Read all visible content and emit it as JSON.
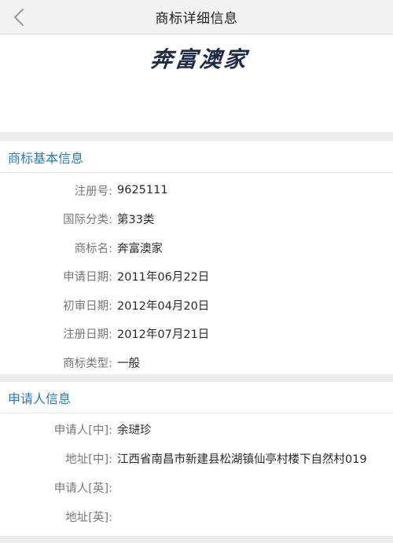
{
  "header": {
    "title": "商标详细信息",
    "back_icon": "chevron-left-icon"
  },
  "logo": {
    "text": "奔富澳家"
  },
  "basic_info": {
    "title": "商标基本信息",
    "rows": [
      {
        "label": "注册号:",
        "value": "9625111"
      },
      {
        "label": "国际分类:",
        "value": "第33类"
      },
      {
        "label": "商标名:",
        "value": "奔富澳家"
      },
      {
        "label": "申请日期:",
        "value": "2011年06月22日"
      },
      {
        "label": "初审日期:",
        "value": "2012年04月20日"
      },
      {
        "label": "注册日期:",
        "value": "2012年07月21日"
      },
      {
        "label": "商标类型:",
        "value": "一般"
      }
    ]
  },
  "applicant_info": {
    "title": "申请人信息",
    "rows": [
      {
        "label": "申请人[中]:",
        "value": "余琎珍"
      },
      {
        "label": "地址[中]:",
        "value": "江西省南昌市新建县松湖镇仙亭村楼下自然村019"
      },
      {
        "label": "申请人[英]:",
        "value": ""
      },
      {
        "label": "地址[英]:",
        "value": ""
      }
    ]
  },
  "colors": {
    "section_title": "#2d79b5",
    "label": "#777777",
    "value": "#2a2a2a",
    "background": "#ececec"
  }
}
